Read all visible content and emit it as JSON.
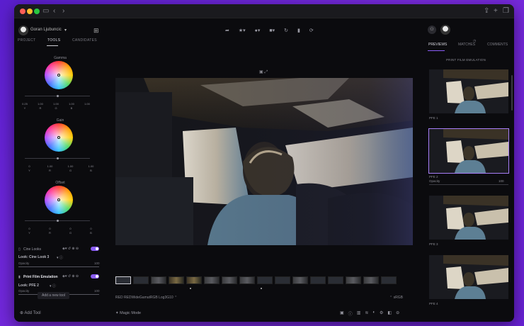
{
  "user": {
    "name": "Goran Ljubuncic"
  },
  "left_tabs": [
    {
      "label": "PROJECT"
    },
    {
      "label": "TOOLS"
    },
    {
      "label": "CANDIDATES"
    }
  ],
  "wheels": [
    {
      "label": "Gamma",
      "values": [
        "0.25",
        "1.00",
        "1.00",
        "1.00",
        "1.00"
      ],
      "value_labels": [
        "Y",
        "R",
        "G",
        "B"
      ]
    },
    {
      "label": "Gain",
      "values": [
        "0",
        "1.00",
        "1.00",
        "1.00"
      ],
      "value_labels": [
        "Y",
        "R",
        "G",
        "B"
      ]
    },
    {
      "label": "Offset",
      "values": [
        "0",
        "0",
        "0",
        "0"
      ],
      "value_labels": [
        "Y",
        "R",
        "G",
        "B"
      ]
    }
  ],
  "cine_looks": {
    "title": "Cine Looks",
    "look_label": "Look: Cine Look 3",
    "opacity_label": "Opacity",
    "opacity_value": "100"
  },
  "print_film": {
    "title": "Print Film Emulation",
    "look_label": "Look: PFE 2",
    "opacity_label": "Opacity",
    "opacity_value": "100"
  },
  "tooltip": "Add a new tool",
  "add_tool": "Add Tool",
  "colorspace_left": "RED REDWideGamutRGB Log3G10",
  "colorspace_right": "sRGB",
  "magic_mode": "Magic Mode",
  "right_tabs": [
    {
      "label": "PREVIEWS"
    },
    {
      "label": "MATCHES"
    },
    {
      "label": "COMMENTS"
    }
  ],
  "previews_title": "PRINT FILM EMULATION",
  "previews": [
    {
      "label": "PFE 1"
    },
    {
      "label": "PFE 2",
      "opacity_label": "Opacity",
      "opacity_value": "100"
    },
    {
      "label": "PFE 3"
    },
    {
      "label": "PFE 4"
    }
  ]
}
